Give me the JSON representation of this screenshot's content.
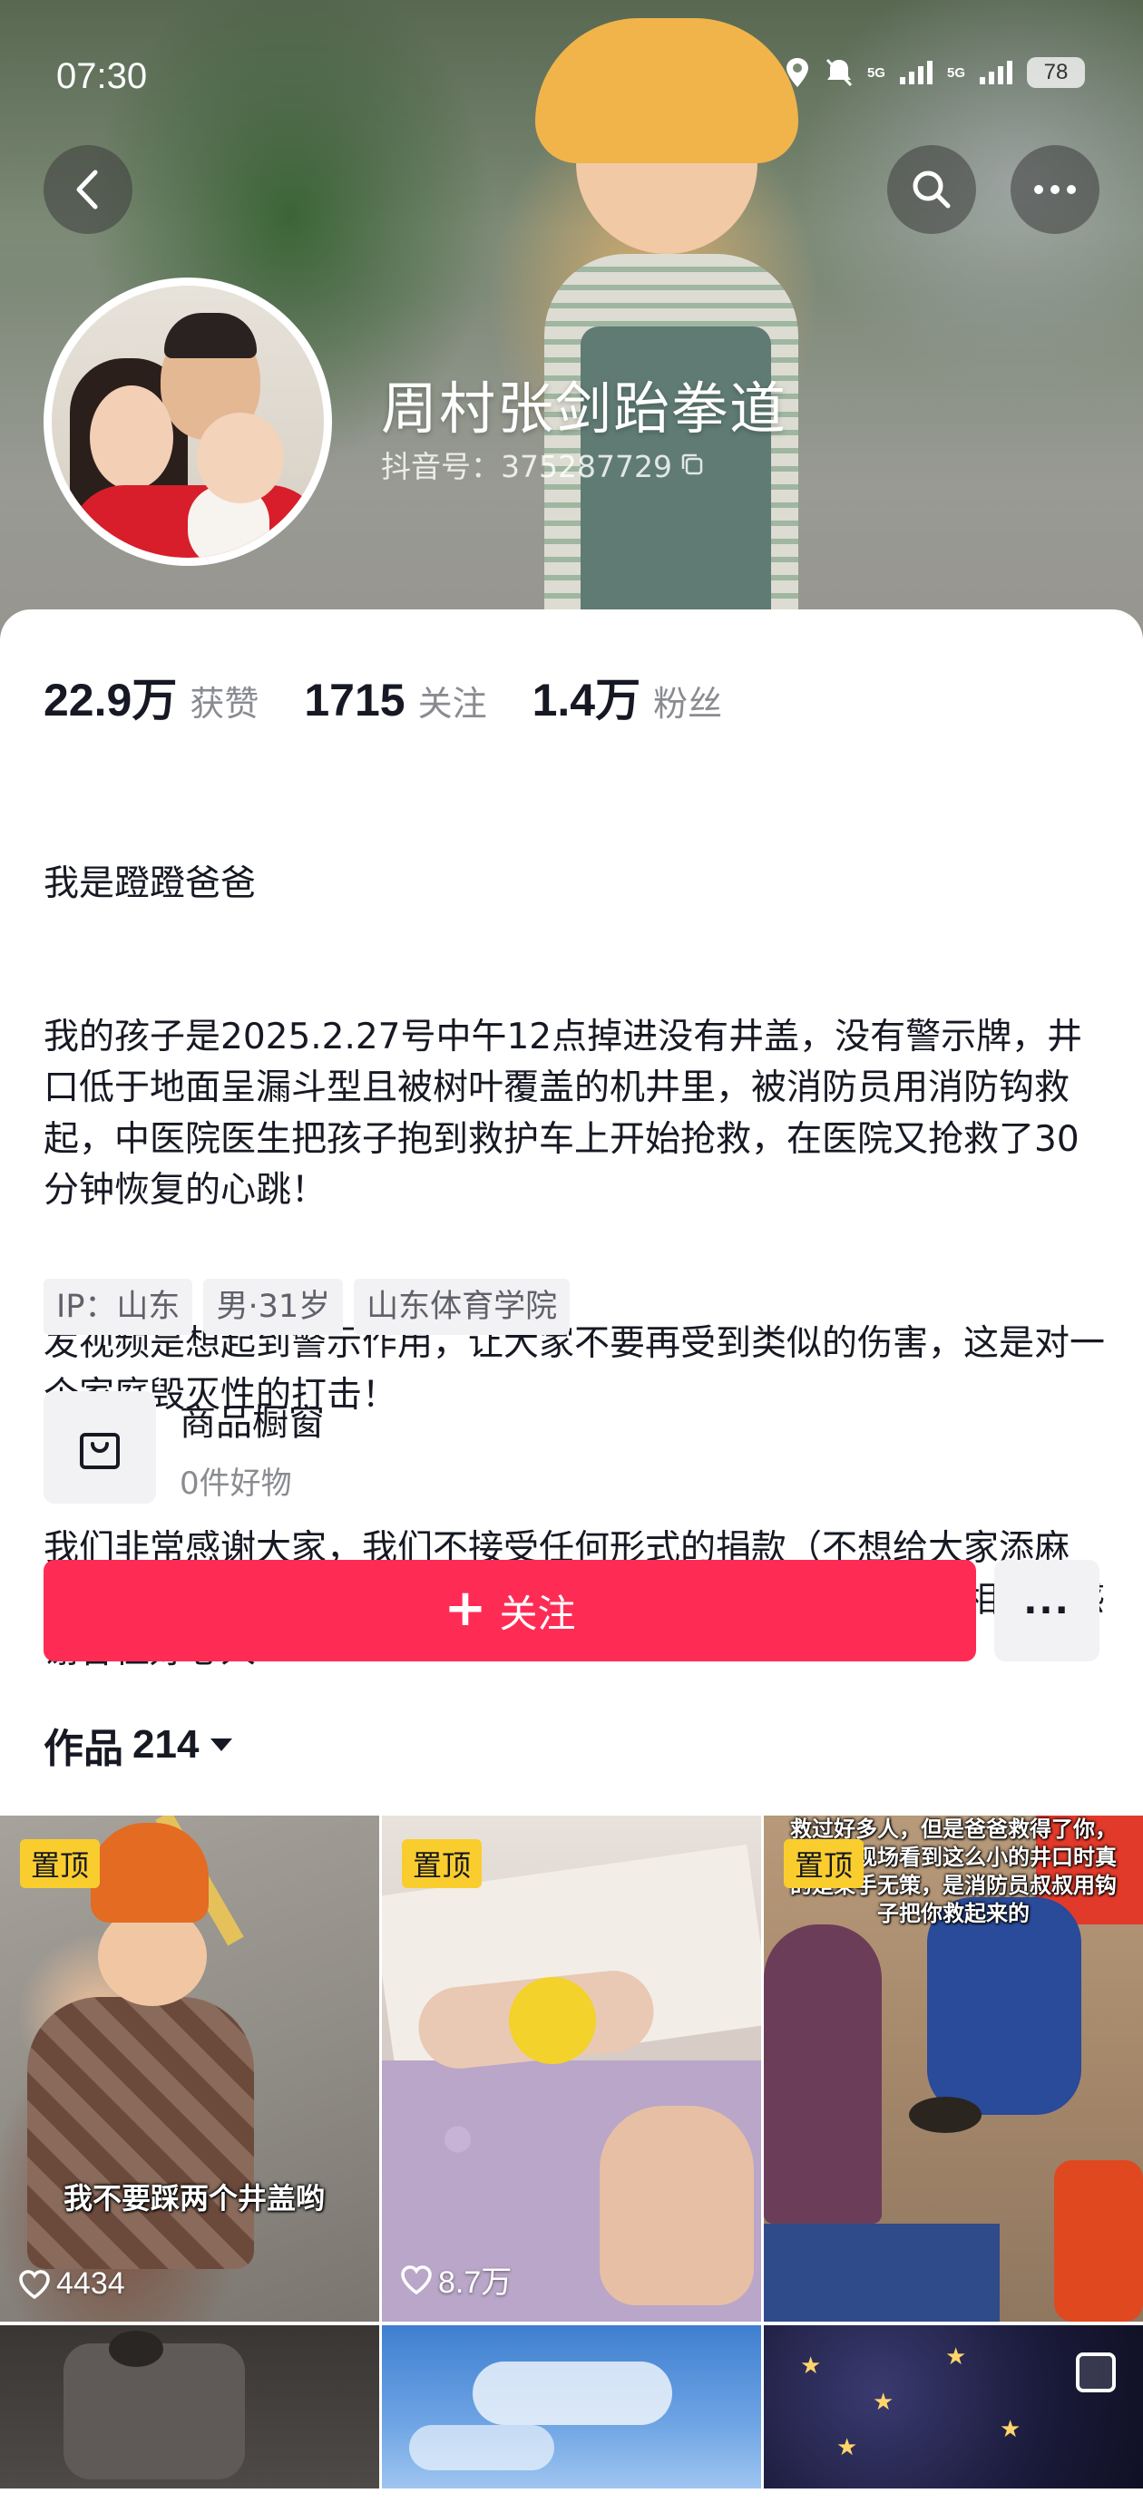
{
  "status_bar": {
    "time": "07:30",
    "network_1": "5G",
    "network_2": "5G",
    "battery": "78"
  },
  "profile": {
    "name": "周村张剑跆拳道",
    "douyin_id": "抖音号：375287729"
  },
  "stats": {
    "likes_value": "22.9万",
    "likes_label": "获赞",
    "following_value": "1715",
    "following_label": "关注",
    "followers_value": "1.4万",
    "followers_label": "粉丝"
  },
  "bio": {
    "line1": "我是蹬蹬爸爸",
    "line2": "我的孩子是2025.2.27号中午12点掉进没有井盖，没有警示牌，井口低于地面呈漏斗型且被树叶覆盖的机井里，被消防员用消防钩救起，中医院医生把孩子抱到救护车上开始抢救，在医院又抢救了30分钟恢复的心跳！",
    "line3": "发视频是想起到警示作用，让大家不要再受到类似的伤害，这是对一个家庭毁灭性的打击！",
    "line4": "我们非常感谢大家，我们不接受任何形式的捐款（不想给大家添麻烦）！如果有人借此事向大家要钱，那都是骗子，大家不要相信！感谢各位好心人"
  },
  "tags": [
    "IP：山东",
    "男·31岁",
    "山东体育学院"
  ],
  "shop": {
    "title": "商品橱窗",
    "subtitle": "0件好物"
  },
  "actions": {
    "follow_label": "关注",
    "more_label": "···"
  },
  "works": {
    "label": "作品",
    "count": "214"
  },
  "videos": [
    {
      "pinned": "置顶",
      "caption": "我不要踩两个井盖哟",
      "likes": "4434"
    },
    {
      "pinned": "置顶",
      "likes": "8.7万"
    },
    {
      "pinned": "置顶",
      "overlay": "救过好多人，但是爸爸救得了你，当我到现场看到这么小的井口时真的是束手无策，是消防员叔叔用钩子把你救起来的"
    }
  ],
  "colors": {
    "accent": "#fe2c55",
    "pin": "#facd2e",
    "muted_text": "#8a8b91"
  },
  "icons": {
    "back": "chevron-left-icon",
    "search": "search-icon",
    "more": "more-horizontal-icon",
    "copy": "copy-icon",
    "shop": "shopping-bag-icon",
    "heart": "heart-icon",
    "dropdown": "caret-down-icon"
  }
}
